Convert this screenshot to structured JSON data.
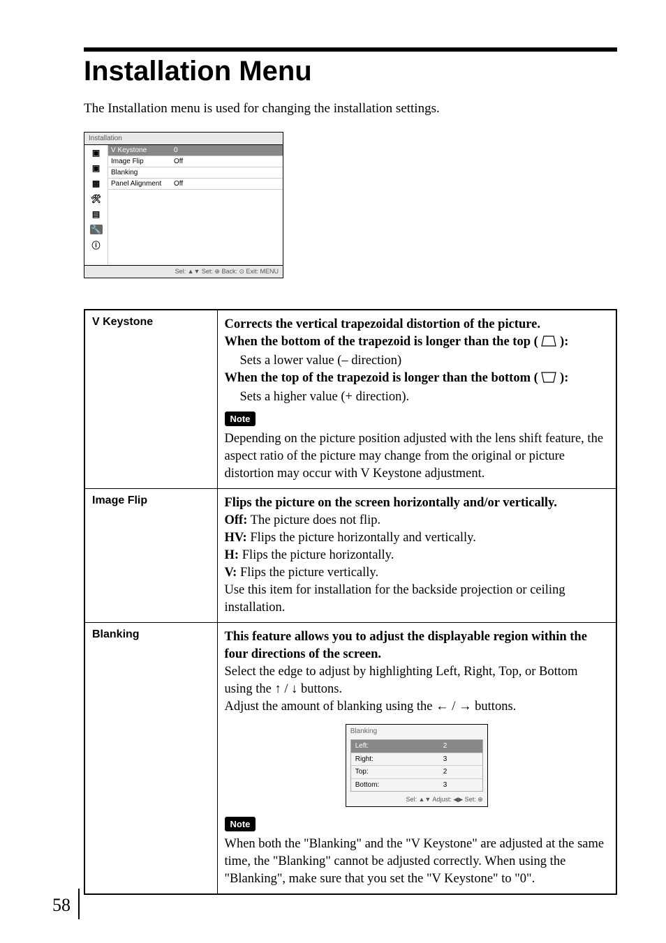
{
  "page_title": "Installation Menu",
  "intro": "The Installation menu is used for changing the installation settings.",
  "osd": {
    "title": "Installation",
    "rows": [
      {
        "label": "V Keystone",
        "value": "0",
        "selected": true
      },
      {
        "label": "Image Flip",
        "value": "Off",
        "selected": false
      },
      {
        "label": "Blanking",
        "value": "",
        "selected": false
      },
      {
        "label": "Panel Alignment",
        "value": "Off",
        "selected": false
      }
    ],
    "footer": "Sel: ▲▼   Set: ⊕   Back: ⊙   Exit: MENU"
  },
  "table": {
    "vkeystone": {
      "label": "V Keystone",
      "l1": "Corrects the vertical trapezoidal distortion of the picture.",
      "l2a": "When the bottom of the trapezoid is longer than the top (",
      "l2b": "):",
      "l3": "Sets a lower value (– direction)",
      "l4a": "When the top of the trapezoid is longer than the bottom (",
      "l4b": "):",
      "l5": "Sets a higher value (+ direction).",
      "note_label": "Note",
      "note_body": "Depending on the picture position adjusted with the lens shift feature, the aspect ratio of the picture may change from the original or picture distortion may occur with V Keystone adjustment."
    },
    "imageflip": {
      "label": "Image Flip",
      "l1": "Flips the picture on the screen horizontally and/or vertically.",
      "off_b": "Off:",
      "off_t": " The picture does not flip.",
      "hv_b": "HV:",
      "hv_t": " Flips the picture horizontally and vertically.",
      "h_b": "H:",
      "h_t": " Flips the picture horizontally.",
      "v_b": "V:",
      "v_t": " Flips the picture vertically.",
      "tail": "Use this item for installation for the backside projection or ceiling installation."
    },
    "blanking": {
      "label": "Blanking",
      "l1": "This feature allows you to adjust the displayable region within the four directions of the screen.",
      "l2": "Select the edge to adjust by highlighting Left, Right, Top, or Bottom using the ",
      "l2b": " buttons.",
      "l3": "Adjust the amount of blanking using the ",
      "l3b": " buttons.",
      "sub_title": "Blanking",
      "sub_rows": [
        {
          "label": "Left:",
          "value": "2",
          "selected": true
        },
        {
          "label": "Right:",
          "value": "3",
          "selected": false
        },
        {
          "label": "Top:",
          "value": "2",
          "selected": false
        },
        {
          "label": "Bottom:",
          "value": "3",
          "selected": false
        }
      ],
      "sub_footer": "Sel: ▲▼   Adjust: ◀▶   Set: ⊕",
      "note_label": "Note",
      "note_body": "When both the \"Blanking\" and the \"V Keystone\" are adjusted at the same time, the \"Blanking\" cannot be adjusted correctly. When using the \"Blanking\", make sure that you set the \"V Keystone\" to \"0\"."
    }
  },
  "page_number": "58"
}
